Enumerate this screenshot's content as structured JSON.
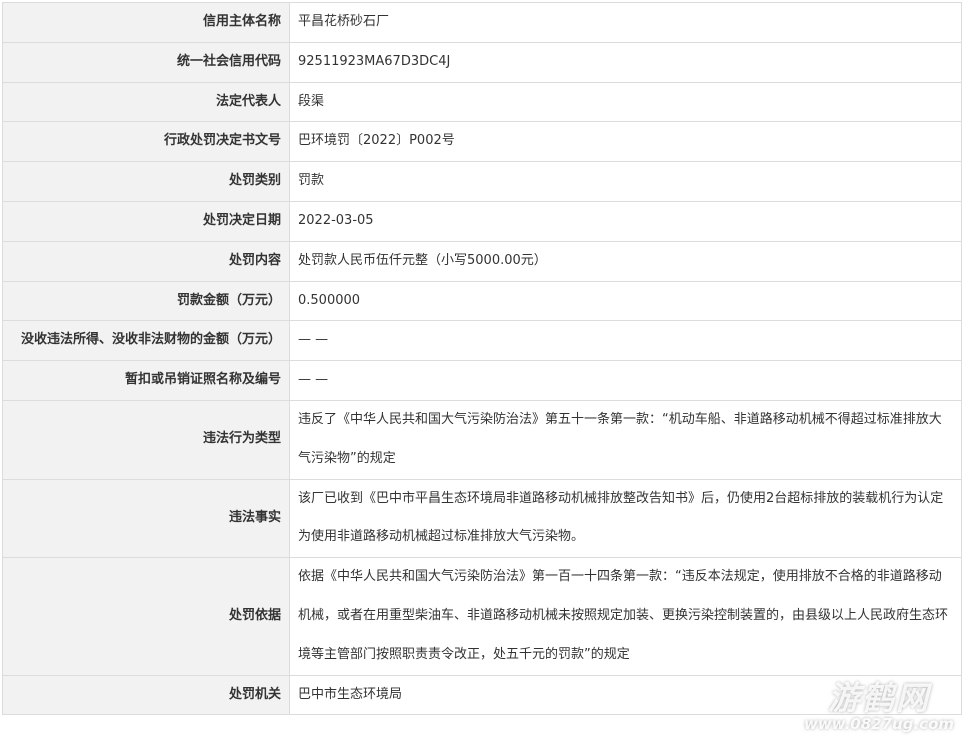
{
  "rows": [
    {
      "label": "信用主体名称",
      "value": "平昌花桥砂石厂"
    },
    {
      "label": "统一社会信用代码",
      "value": "92511923MA67D3DC4J"
    },
    {
      "label": "法定代表人",
      "value": "段渠"
    },
    {
      "label": "行政处罚决定书文号",
      "value": "巴环境罚〔2022〕P002号"
    },
    {
      "label": "处罚类别",
      "value": "罚款"
    },
    {
      "label": "处罚决定日期",
      "value": "2022-03-05"
    },
    {
      "label": "处罚内容",
      "value": "处罚款人民币伍仟元整（小写5000.00元）"
    },
    {
      "label": "罚款金额（万元）",
      "value": "0.500000"
    },
    {
      "label": "没收违法所得、没收非法财物的金额（万元）",
      "value": "— —"
    },
    {
      "label": "暂扣或吊销证照名称及编号",
      "value": "— —"
    },
    {
      "label": "违法行为类型",
      "value": "违反了《中华人民共和国大气污染防治法》第五十一条第一款：“机动车船、非道路移动机械不得超过标准排放大气污染物”的规定"
    },
    {
      "label": "违法事实",
      "value": "该厂已收到《巴中市平昌生态环境局非道路移动机械排放整改告知书》后，仍使用2台超标排放的装载机行为认定为使用非道路移动机械超过标准排放大气污染物。"
    },
    {
      "label": "处罚依据",
      "value": "依据《中华人民共和国大气污染防治法》第一百一十四条第一款：“违反本法规定，使用排放不合格的非道路移动机械，或者在用重型柴油车、非道路移动机械未按照规定加装、更换污染控制装置的，由县级以上人民政府生态环境等主管部门按照职责责令改正，处五千元的罚款”的规定"
    },
    {
      "label": "处罚机关",
      "value": "巴中市生态环境局"
    }
  ],
  "watermark": {
    "logo": "游鹤网",
    "url": "www.0827ug.com"
  }
}
